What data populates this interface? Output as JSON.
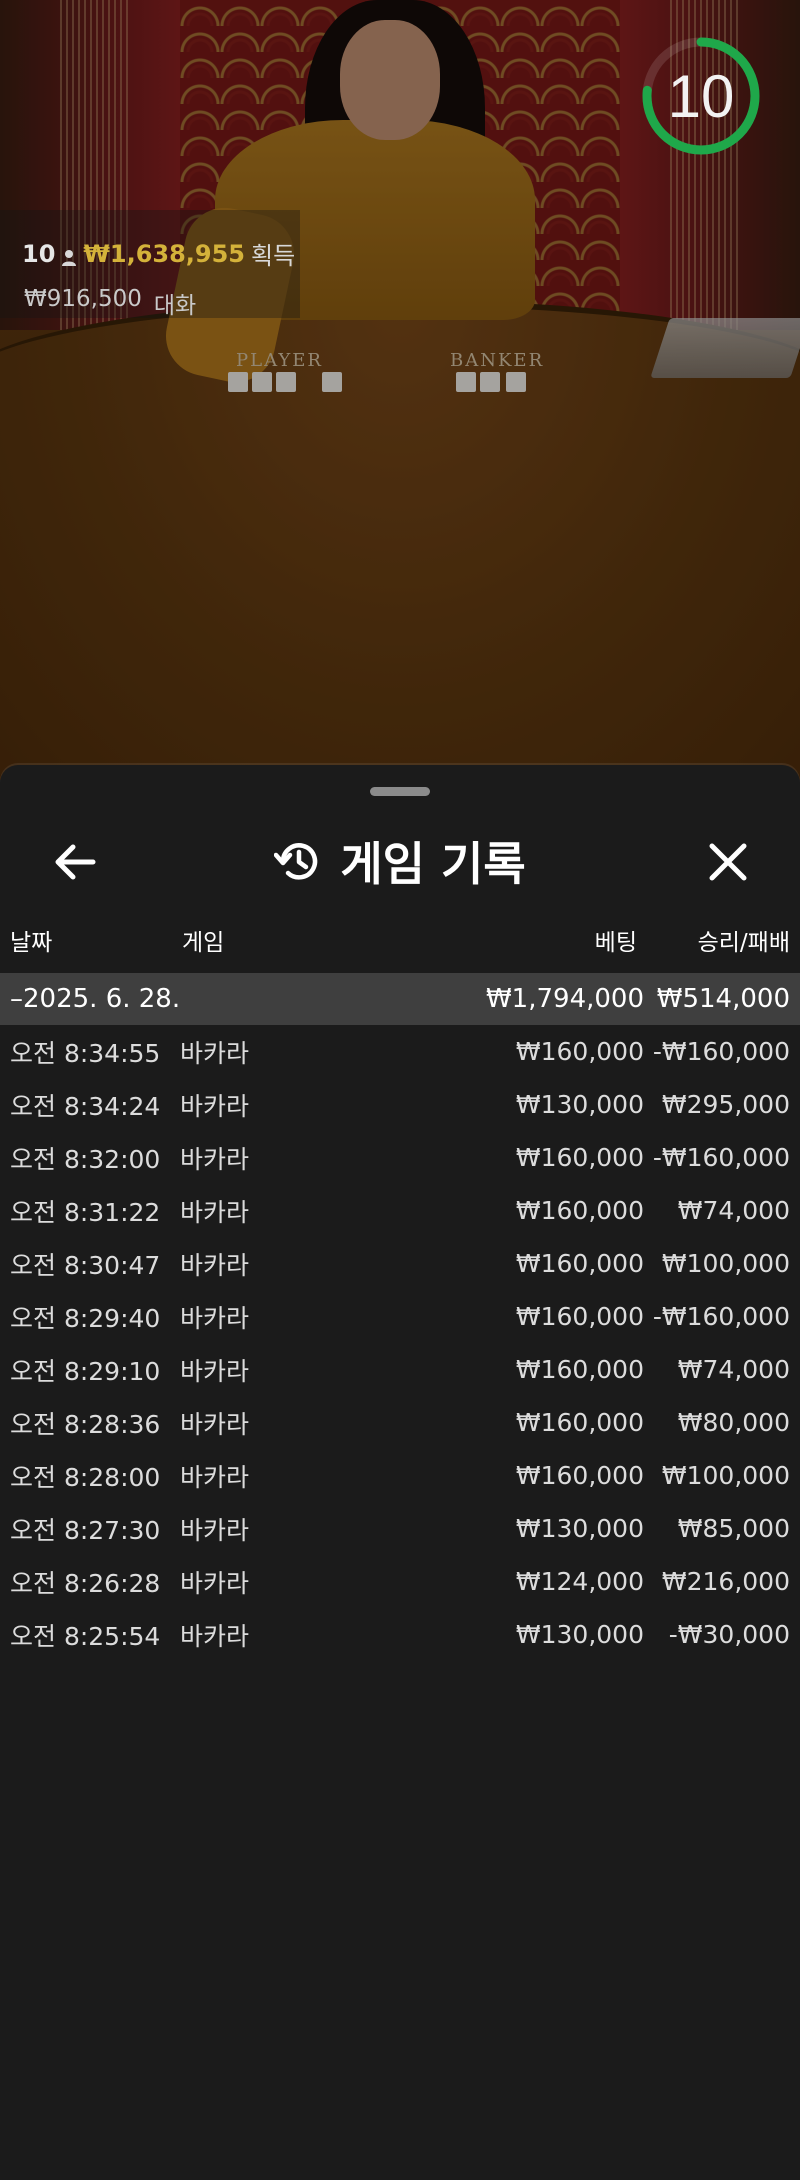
{
  "live": {
    "timer": "10",
    "players": "10",
    "win_amount": "₩1,638,955",
    "win_label": "획득",
    "wager_amount": "₩916,500",
    "wager_label": "대화",
    "player_label": "PLAYER",
    "banker_label": "BANKER",
    "timer_color": "#1fa84a"
  },
  "sheet": {
    "title": "게임 기록",
    "icons": {
      "back": "arrow-left-icon",
      "history": "history-icon",
      "close": "close-icon"
    },
    "columns": {
      "date": "날짜",
      "game": "게임",
      "bet": "베팅",
      "pl": "승리/패배"
    },
    "day": {
      "date": "–2025. 6. 28.",
      "bet": "₩1,794,000",
      "pl": "₩514,000"
    },
    "rows": [
      {
        "time": "오전 8:34:55",
        "game": "바카라",
        "bet": "₩160,000",
        "pl": "-₩160,000"
      },
      {
        "time": "오전 8:34:24",
        "game": "바카라",
        "bet": "₩130,000",
        "pl": "₩295,000"
      },
      {
        "time": "오전 8:32:00",
        "game": "바카라",
        "bet": "₩160,000",
        "pl": "-₩160,000"
      },
      {
        "time": "오전 8:31:22",
        "game": "바카라",
        "bet": "₩160,000",
        "pl": "₩74,000"
      },
      {
        "time": "오전 8:30:47",
        "game": "바카라",
        "bet": "₩160,000",
        "pl": "₩100,000"
      },
      {
        "time": "오전 8:29:40",
        "game": "바카라",
        "bet": "₩160,000",
        "pl": "-₩160,000"
      },
      {
        "time": "오전 8:29:10",
        "game": "바카라",
        "bet": "₩160,000",
        "pl": "₩74,000"
      },
      {
        "time": "오전 8:28:36",
        "game": "바카라",
        "bet": "₩160,000",
        "pl": "₩80,000"
      },
      {
        "time": "오전 8:28:00",
        "game": "바카라",
        "bet": "₩160,000",
        "pl": "₩100,000"
      },
      {
        "time": "오전 8:27:30",
        "game": "바카라",
        "bet": "₩130,000",
        "pl": "₩85,000"
      },
      {
        "time": "오전 8:26:28",
        "game": "바카라",
        "bet": "₩124,000",
        "pl": "₩216,000"
      },
      {
        "time": "오전 8:25:54",
        "game": "바카라",
        "bet": "₩130,000",
        "pl": "-₩30,000"
      }
    ]
  }
}
